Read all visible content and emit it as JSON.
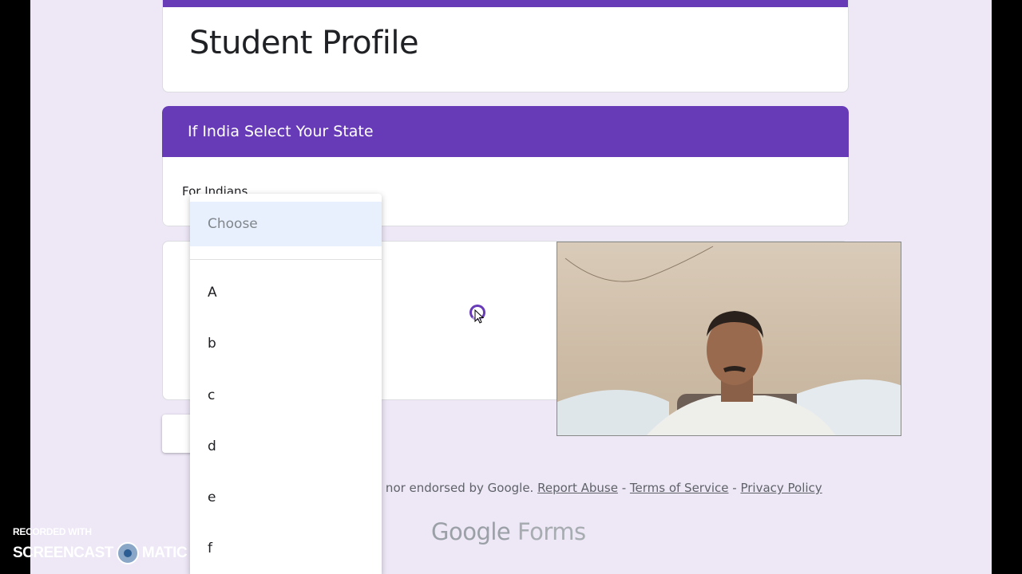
{
  "form": {
    "title": "Student Profile",
    "section_title": "If India Select Your State",
    "section_description": "For Indians"
  },
  "dropdown": {
    "placeholder": "Choose",
    "options": [
      "A",
      "b",
      "c",
      "d",
      "e",
      "f"
    ]
  },
  "footer": {
    "text": "l nor endorsed by Google.",
    "report_abuse": "Report Abuse",
    "sep1": " - ",
    "terms": "Terms of Service",
    "sep2": " - ",
    "privacy": "Privacy Policy",
    "logo_google": "Google",
    "logo_forms": "Forms"
  },
  "watermark": {
    "line1": "RECORDED WITH",
    "line2_left": "SCREENCAST",
    "line2_right": "MATIC"
  },
  "colors": {
    "accent": "#673ab7",
    "background": "#ede7f6",
    "highlight": "#e8f0fe"
  }
}
